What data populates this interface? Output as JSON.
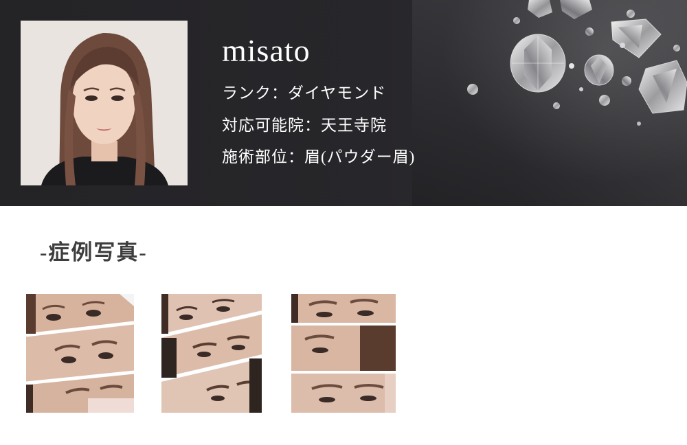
{
  "profile": {
    "name": "misato",
    "rank": "ランク：ダイヤモンド",
    "clinic": "対応可能院：天王寺院",
    "part": "施術部位：眉(パウダー眉)"
  },
  "gallery": {
    "title": "-症例写真-"
  },
  "colors": {
    "header_bg": "#242326",
    "header_text": "#ffffff",
    "section_title": "#3d3d3d"
  }
}
